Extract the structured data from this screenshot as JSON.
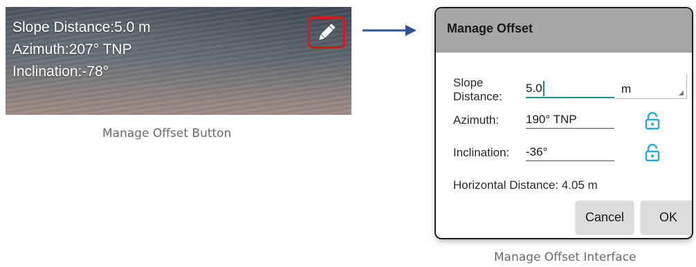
{
  "camera_overlay": {
    "slope_distance": "Slope Distance:5.0 m",
    "azimuth": "Azimuth:207° TNP",
    "inclination": "Inclination:-78°",
    "edit_icon": "pencil-icon"
  },
  "captions": {
    "left": "Manage Offset Button",
    "right": "Manage Offset Interface"
  },
  "dialog": {
    "title": "Manage Offset",
    "slope_label_line1": "Slope",
    "slope_label_line2": "Distance:",
    "slope_value": "5.0",
    "unit": "m",
    "azimuth_label": "Azimuth:",
    "azimuth_value": "190° TNP",
    "inclination_label": "Inclination:",
    "inclination_value": "-36°",
    "horizontal_distance": "Horizontal Distance: 4.05 m",
    "cancel_label": "Cancel",
    "ok_label": "OK",
    "lock_icon": "unlocked-padlock-icon"
  },
  "colors": {
    "highlight": "#e0141e",
    "accent": "#1e8e8e",
    "lock": "#2aa9d6",
    "arrow": "#2f5597"
  }
}
